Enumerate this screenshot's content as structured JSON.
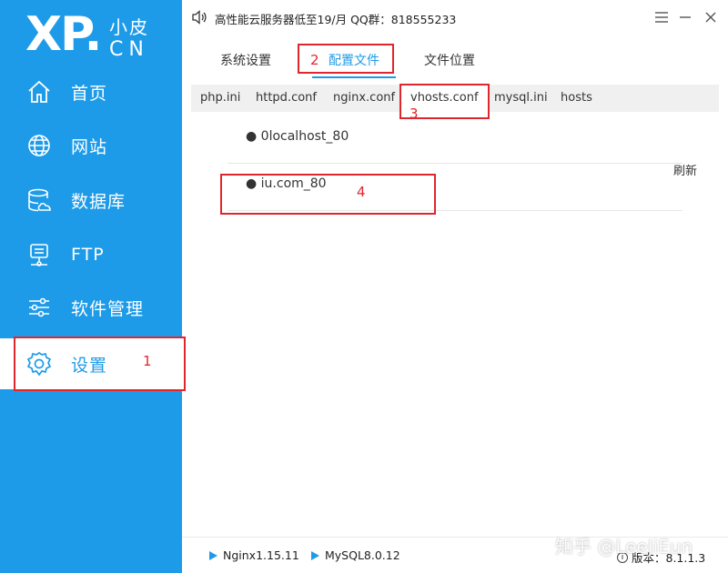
{
  "logo": {
    "mark": "XP.",
    "top_text": "小皮",
    "bottom_text": "CN"
  },
  "sidebar": {
    "items": [
      {
        "label": "首页",
        "icon": "home-icon"
      },
      {
        "label": "网站",
        "icon": "globe-icon"
      },
      {
        "label": "数据库",
        "icon": "database-icon"
      },
      {
        "label": "FTP",
        "icon": "ftp-server-icon"
      },
      {
        "label": "软件管理",
        "icon": "sliders-icon"
      },
      {
        "label": "设置",
        "icon": "gear-icon",
        "active": true
      }
    ]
  },
  "header": {
    "notice": "高性能云服务器低至19/月  QQ群：818555233",
    "menu_icon": "menu-icon",
    "minimize_icon": "minimize-icon",
    "close_icon": "close-icon"
  },
  "tabs": [
    {
      "label": "系统设置"
    },
    {
      "label": "配置文件",
      "active": true
    },
    {
      "label": "文件位置"
    }
  ],
  "subtabs": [
    {
      "label": "php.ini"
    },
    {
      "label": "httpd.conf"
    },
    {
      "label": "nginx.conf"
    },
    {
      "label": "vhosts.conf",
      "active": true
    },
    {
      "label": "mysql.ini"
    },
    {
      "label": "hosts"
    }
  ],
  "refresh_label": "刷新",
  "sites": [
    {
      "label": "● 0localhost_80"
    },
    {
      "label": "● iu.com_80"
    }
  ],
  "status": {
    "nginx": "Nginx1.15.11",
    "mysql": "MySQL8.0.12",
    "version": "版本：8.1.1.3"
  },
  "watermark": "知乎 @LeeJiEun",
  "annotations": [
    "1",
    "2",
    "3",
    "4"
  ],
  "colors": {
    "accent": "#1e9be8",
    "annotation": "#e0262d"
  }
}
